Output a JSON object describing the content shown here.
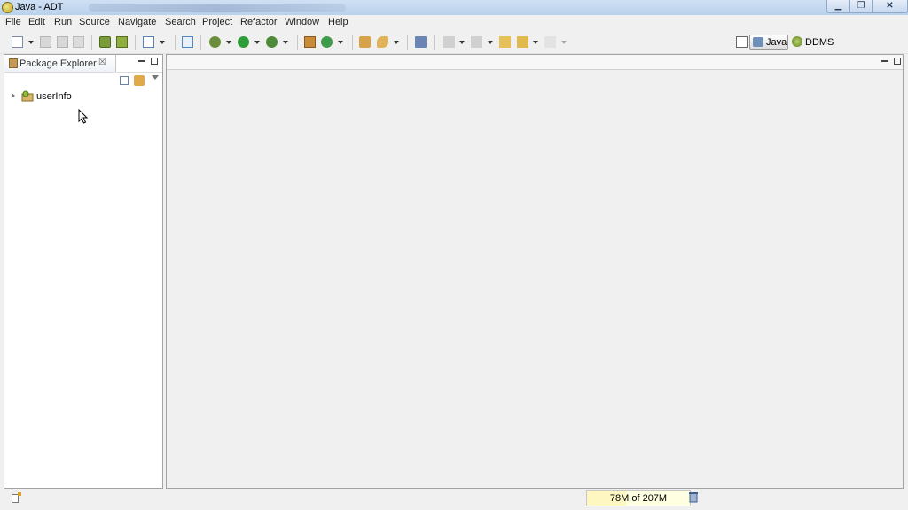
{
  "window": {
    "title": "Java - ADT",
    "minimize": "▁",
    "maximize": "❐",
    "close": "✕"
  },
  "menu": [
    "File",
    "Edit",
    "Run",
    "Source",
    "Navigate",
    "Search",
    "Project",
    "Refactor",
    "Window",
    "Help"
  ],
  "toolbar": {
    "icons": [
      "new-icon",
      "save-icon",
      "save-all-icon",
      "print-icon",
      "android-sdk-manager-icon",
      "avd-manager-icon",
      "lint-check-icon",
      "new-android-project-icon",
      "debug-icon",
      "run-icon",
      "external-tools-icon",
      "new-java-package-icon",
      "new-java-class-icon",
      "open-type-icon",
      "search-icon",
      "toggle-mark-occurrences-icon",
      "next-annotation-icon",
      "previous-annotation-icon",
      "last-edit-location-icon",
      "back-icon",
      "forward-icon"
    ]
  },
  "perspectives": {
    "java": "Java",
    "ddms": "DDMS"
  },
  "package_explorer": {
    "tab_label": "Package Explorer",
    "close_glyph": "☒",
    "projects": [
      {
        "label": "userInfo",
        "expanded": false
      }
    ]
  },
  "status": {
    "memory": "78M of 207M",
    "memory_used_fraction": 0.377
  }
}
